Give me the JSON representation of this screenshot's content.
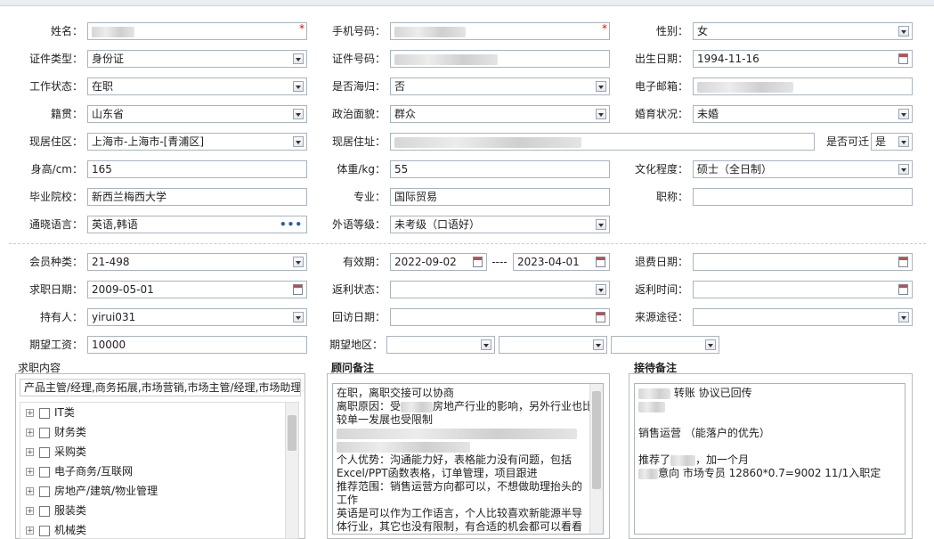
{
  "form": {
    "name_label": "姓名：",
    "phone_label": "手机号码：",
    "gender_label": "性别：",
    "gender_value": "女",
    "idtype_label": "证件类型：",
    "idtype_value": "身份证",
    "idnum_label": "证件号码：",
    "birth_label": "出生日期：",
    "birth_value": "1994-11-16",
    "workstatus_label": "工作状态：",
    "workstatus_value": "在职",
    "overseas_label": "是否海归：",
    "overseas_value": "否",
    "email_label": "电子邮箱：",
    "native_label": "籍贯：",
    "native_value": "山东省",
    "political_label": "政治面貌：",
    "political_value": "群众",
    "marital_label": "婚育状况：",
    "marital_value": "未婚",
    "region_label": "现居住区：",
    "region_value": "上海市-上海市-[青浦区]",
    "address_label": "现居住址：",
    "relocate_label": "是否可迁",
    "relocate_value": "是",
    "height_label": "身高/cm：",
    "height_value": "165",
    "weight_label": "体重/kg：",
    "weight_value": "55",
    "education_label": "文化程度：",
    "education_value": "硕士（全日制）",
    "school_label": "毕业院校：",
    "school_value": "新西兰梅西大学",
    "major_label": "专业：",
    "major_value": "国际贸易",
    "title_label": "职称：",
    "languages_label": "通晓语言：",
    "languages_value": "英语,韩语",
    "langlevel_label": "外语等级：",
    "langlevel_value": "未考级（口语好）",
    "membertype_label": "会员种类：",
    "membertype_value": "21-498",
    "validity_label": "有效期：",
    "validity_from": "2022-09-02",
    "validity_sep": "----",
    "validity_to": "2023-04-01",
    "refund_label": "退费日期：",
    "jobdate_label": "求职日期：",
    "jobdate_value": "2009-05-01",
    "rebate_status_label": "返利状态：",
    "rebate_time_label": "返利时间：",
    "holder_label": "持有人：",
    "holder_value": "yirui031",
    "revisit_label": "回访日期：",
    "source_label": "来源途径：",
    "salary_label": "期望工资：",
    "salary_value": "10000",
    "area_label": "期望地区："
  },
  "job_panel": {
    "title": "求职内容",
    "selected": "产品主管/经理,商务拓展,市场营销,市场主管/经理,市场助理",
    "items": [
      "IT类",
      "财务类",
      "采购类",
      "电子商务/互联网",
      "房地产/建筑/物业管理",
      "服装类",
      "机械类"
    ]
  },
  "advisor_panel": {
    "title": "顾问备注",
    "lines": [
      "在职，离职交接可以协商",
      "离职原因：受      房地产行业的影响，另外行业也比",
      "较单一发展也受限制",
      "",
      "",
      "个人优势：沟通能力好，表格能力没有问题，包括",
      "Excel/PPT函数表格，订单管理，项目跟进",
      "推荐范围：销售运营方向都可以，不想做助理抬头的",
      "工作",
      "英语是可以作为工作语言，个人比较喜欢新能源半导",
      "体行业，其它也没有限制，有合适的机会都可以看看"
    ]
  },
  "reception_panel": {
    "title": "接待备注",
    "lines": [
      "转账 协议已回传",
      "",
      "",
      "销售运营 （能落户的优先）",
      "",
      "推荐了    ，加一个月",
      "意向 市场专员 12860*0.7=9002 11/1入职定"
    ]
  },
  "icons": [
    "calendar-icon",
    "dropdown-arrow-icon",
    "expand-plus-icon",
    "more-dots-icon"
  ],
  "colors": {
    "required": "#ee0000",
    "border": "#a9b4c1",
    "accent": "#2a5db0"
  }
}
